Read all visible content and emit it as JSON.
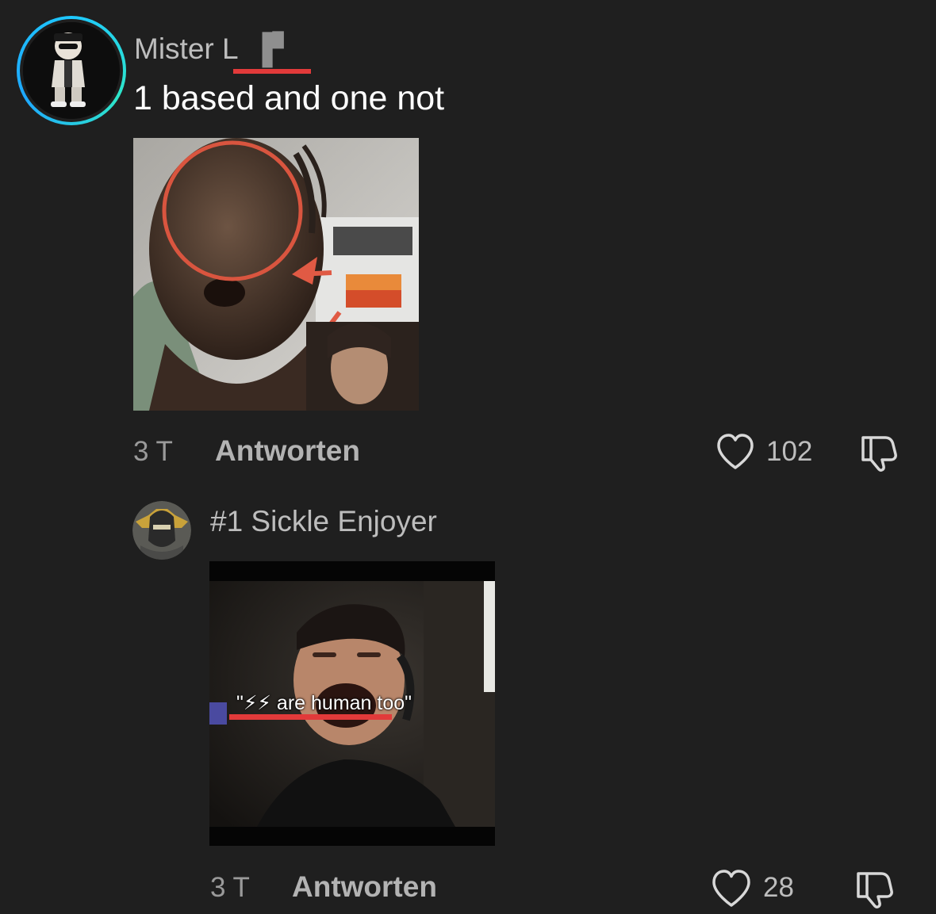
{
  "comments": [
    {
      "username": "Mister L",
      "badge": "▐▘",
      "text": "1 based and one not",
      "time": "3 T",
      "reply_label": "Antworten",
      "likes": "102"
    },
    {
      "username": "#1 Sickle Enjoyer",
      "media_caption": "\"⚡⚡ are human too\"",
      "time": "3 T",
      "reply_label": "Antworten",
      "likes": "28"
    }
  ],
  "colors": {
    "background": "#1f1f1f",
    "accent_underline": "#e23a3a",
    "avatar_ring": "#1ec8ff"
  },
  "icons": [
    "heart-icon",
    "dislike-icon"
  ]
}
